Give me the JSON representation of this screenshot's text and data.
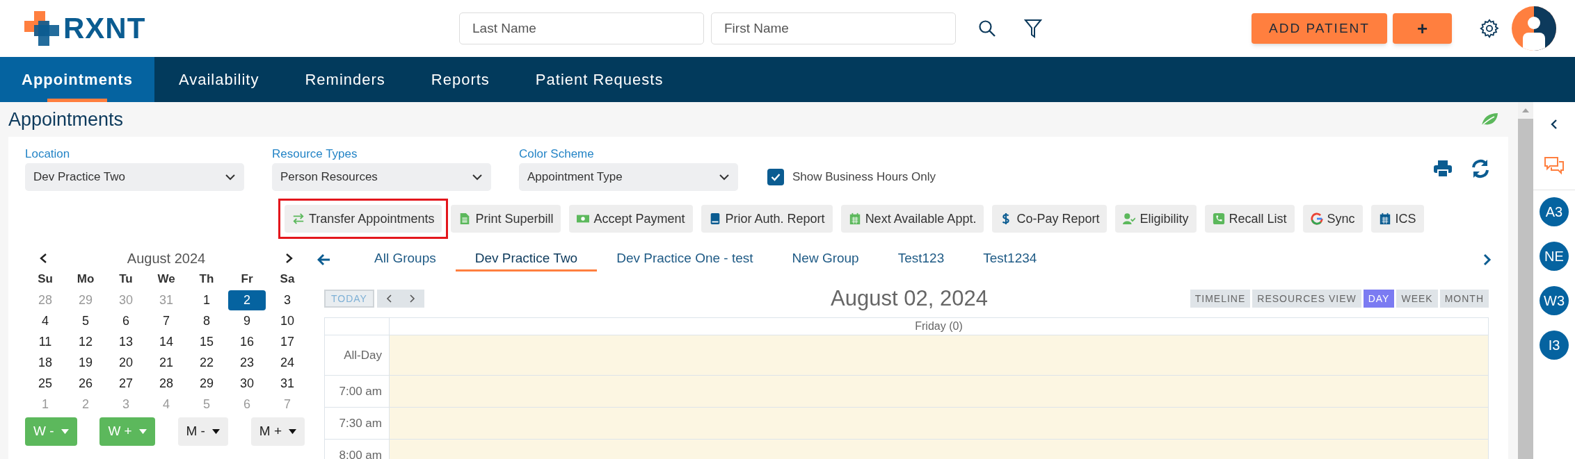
{
  "logo": {
    "text": "RXNT"
  },
  "search_fields": [
    {
      "placeholder": "Last Name"
    },
    {
      "placeholder": "First Name"
    }
  ],
  "header_buttons": [
    {
      "label": "ADD PATIENT"
    },
    {
      "label": "+"
    }
  ],
  "nav_tabs": [
    {
      "label": "Appointments",
      "selected": true
    },
    {
      "label": "Availability",
      "selected": false
    },
    {
      "label": "Reminders",
      "selected": false
    },
    {
      "label": "Reports",
      "selected": false
    },
    {
      "label": "Patient Requests",
      "selected": false
    }
  ],
  "page_title": "Appointments",
  "filters": [
    {
      "label": "Location",
      "value": "Dev Practice Two"
    },
    {
      "label": "Resource Types",
      "value": "Person Resources"
    },
    {
      "label": "Color Scheme",
      "value": "Appointment Type"
    }
  ],
  "business_hours": {
    "label": "Show Business Hours Only",
    "checked": true
  },
  "toolbar": [
    {
      "label": "Transfer Appointments",
      "kind": "transfer",
      "highlighted": true
    },
    {
      "label": "Print Superbill",
      "kind": "document",
      "highlighted": false
    },
    {
      "label": "Accept Payment",
      "kind": "cash",
      "highlighted": false
    },
    {
      "label": "Prior Auth. Report",
      "kind": "book",
      "highlighted": false
    },
    {
      "label": "Next Available Appt.",
      "kind": "calendargreen",
      "highlighted": false
    },
    {
      "label": "Co-Pay Report",
      "kind": "dollar",
      "highlighted": false
    },
    {
      "label": "Eligibility",
      "kind": "usercheck",
      "highlighted": false
    },
    {
      "label": "Recall List",
      "kind": "phone",
      "highlighted": false
    },
    {
      "label": "Sync",
      "kind": "google",
      "highlighted": false
    },
    {
      "label": "ICS",
      "kind": "calendarblue",
      "highlighted": false
    }
  ],
  "mini_calendar": {
    "title": "August 2024",
    "weekdays": [
      "Su",
      "Mo",
      "Tu",
      "We",
      "Th",
      "Fr",
      "Sa"
    ],
    "weeks": [
      [
        {
          "day": "28",
          "outside_month": true,
          "selected": false
        },
        {
          "day": "29",
          "outside_month": true,
          "selected": false
        },
        {
          "day": "30",
          "outside_month": true,
          "selected": false
        },
        {
          "day": "31",
          "outside_month": true,
          "selected": false
        },
        {
          "day": "1",
          "outside_month": false,
          "selected": false
        },
        {
          "day": "2",
          "outside_month": false,
          "selected": true
        },
        {
          "day": "3",
          "outside_month": false,
          "selected": false
        }
      ],
      [
        {
          "day": "4",
          "outside_month": false,
          "selected": false
        },
        {
          "day": "5",
          "outside_month": false,
          "selected": false
        },
        {
          "day": "6",
          "outside_month": false,
          "selected": false
        },
        {
          "day": "7",
          "outside_month": false,
          "selected": false
        },
        {
          "day": "8",
          "outside_month": false,
          "selected": false
        },
        {
          "day": "9",
          "outside_month": false,
          "selected": false
        },
        {
          "day": "10",
          "outside_month": false,
          "selected": false
        }
      ],
      [
        {
          "day": "11",
          "outside_month": false,
          "selected": false
        },
        {
          "day": "12",
          "outside_month": false,
          "selected": false
        },
        {
          "day": "13",
          "outside_month": false,
          "selected": false
        },
        {
          "day": "14",
          "outside_month": false,
          "selected": false
        },
        {
          "day": "15",
          "outside_month": false,
          "selected": false
        },
        {
          "day": "16",
          "outside_month": false,
          "selected": false
        },
        {
          "day": "17",
          "outside_month": false,
          "selected": false
        }
      ],
      [
        {
          "day": "18",
          "outside_month": false,
          "selected": false
        },
        {
          "day": "19",
          "outside_month": false,
          "selected": false
        },
        {
          "day": "20",
          "outside_month": false,
          "selected": false
        },
        {
          "day": "21",
          "outside_month": false,
          "selected": false
        },
        {
          "day": "22",
          "outside_month": false,
          "selected": false
        },
        {
          "day": "23",
          "outside_month": false,
          "selected": false
        },
        {
          "day": "24",
          "outside_month": false,
          "selected": false
        }
      ],
      [
        {
          "day": "25",
          "outside_month": false,
          "selected": false
        },
        {
          "day": "26",
          "outside_month": false,
          "selected": false
        },
        {
          "day": "27",
          "outside_month": false,
          "selected": false
        },
        {
          "day": "28",
          "outside_month": false,
          "selected": false
        },
        {
          "day": "29",
          "outside_month": false,
          "selected": false
        },
        {
          "day": "30",
          "outside_month": false,
          "selected": false
        },
        {
          "day": "31",
          "outside_month": false,
          "selected": false
        }
      ],
      [
        {
          "day": "1",
          "outside_month": true,
          "selected": false
        },
        {
          "day": "2",
          "outside_month": true,
          "selected": false
        },
        {
          "day": "3",
          "outside_month": true,
          "selected": false
        },
        {
          "day": "4",
          "outside_month": true,
          "selected": false
        },
        {
          "day": "5",
          "outside_month": true,
          "selected": false
        },
        {
          "day": "6",
          "outside_month": true,
          "selected": false
        },
        {
          "day": "7",
          "outside_month": true,
          "selected": false
        }
      ]
    ]
  },
  "jump_buttons": [
    {
      "label": "W -",
      "color": "#5cb85c"
    },
    {
      "label": "W +",
      "color": "#5cb85c"
    },
    {
      "label": "M -",
      "color": "#eeeeee"
    },
    {
      "label": "M +",
      "color": "#eeeeee"
    }
  ],
  "group_tabs": [
    {
      "label": "All Groups",
      "selected": false
    },
    {
      "label": "Dev Practice Two",
      "selected": true
    },
    {
      "label": "Dev Practice One - test",
      "selected": false
    },
    {
      "label": "New Group",
      "selected": false
    },
    {
      "label": "Test123",
      "selected": false
    },
    {
      "label": "Test1234",
      "selected": false
    }
  ],
  "scheduler": {
    "today_button": "TODAY",
    "title": "August 02, 2024",
    "views": [
      {
        "label": "TIMELINE",
        "selected": false
      },
      {
        "label": "RESOURCES VIEW",
        "selected": false
      },
      {
        "label": "DAY",
        "selected": true
      },
      {
        "label": "WEEK",
        "selected": false
      },
      {
        "label": "MONTH",
        "selected": false
      }
    ],
    "day_header": "Friday (0)",
    "rows": [
      {
        "label": "All-Day"
      },
      {
        "label": "7:00 am"
      },
      {
        "label": "7:30 am"
      },
      {
        "label": "8:00 am"
      }
    ]
  },
  "right_rail": {
    "avatars": [
      "A3",
      "NE",
      "W3",
      "I3"
    ]
  }
}
